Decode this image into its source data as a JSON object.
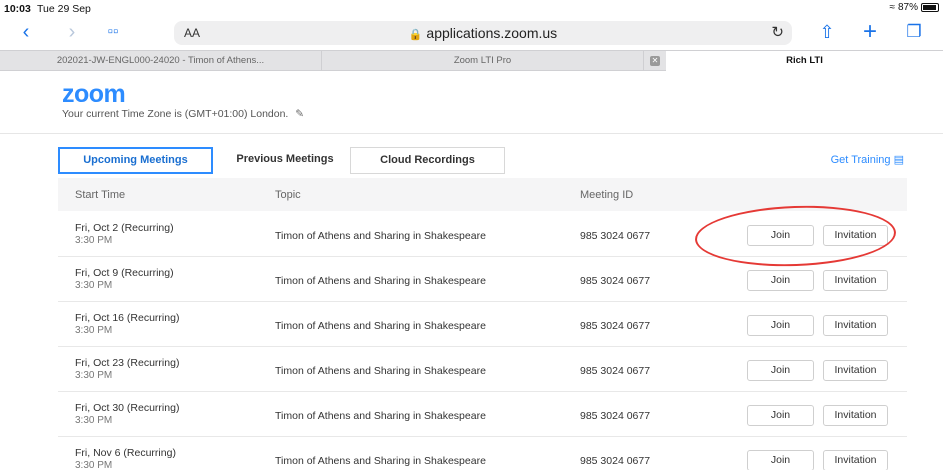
{
  "status_bar": {
    "time": "10:03",
    "date": "Tue 29 Sep",
    "battery": "87%"
  },
  "browser": {
    "text_size_label": "AA",
    "url": "applications.zoom.us",
    "tabs": [
      {
        "label": "202021-JW-ENGL000-24020 - Timon of Athens..."
      },
      {
        "label": "Zoom LTI Pro"
      },
      {
        "label": ""
      },
      {
        "label": "Rich LTI"
      }
    ]
  },
  "zoom": {
    "logo": "zoom",
    "timezone_text": "Your current Time Zone is (GMT+01:00) London.",
    "tabs": [
      "Upcoming Meetings",
      "Previous Meetings",
      "Cloud Recordings"
    ],
    "get_training": "Get Training",
    "columns": {
      "start_time": "Start Time",
      "topic": "Topic",
      "meeting_id": "Meeting ID"
    },
    "join_label": "Join",
    "invitation_label": "Invitation",
    "meetings": [
      {
        "date": "Fri, Oct 2 (Recurring)",
        "time": "3:30 PM",
        "topic": "Timon of Athens and Sharing in Shakespeare",
        "id": "985 3024 0677"
      },
      {
        "date": "Fri, Oct 9 (Recurring)",
        "time": "3:30 PM",
        "topic": "Timon of Athens and Sharing in Shakespeare",
        "id": "985 3024 0677"
      },
      {
        "date": "Fri, Oct 16 (Recurring)",
        "time": "3:30 PM",
        "topic": "Timon of Athens and Sharing in Shakespeare",
        "id": "985 3024 0677"
      },
      {
        "date": "Fri, Oct 23 (Recurring)",
        "time": "3:30 PM",
        "topic": "Timon of Athens and Sharing in Shakespeare",
        "id": "985 3024 0677"
      },
      {
        "date": "Fri, Oct 30 (Recurring)",
        "time": "3:30 PM",
        "topic": "Timon of Athens and Sharing in Shakespeare",
        "id": "985 3024 0677"
      },
      {
        "date": "Fri, Nov 6 (Recurring)",
        "time": "3:30 PM",
        "topic": "Timon of Athens and Sharing in Shakespeare",
        "id": "985 3024 0677"
      }
    ]
  },
  "colors": {
    "accent": "#2d8cff",
    "annotation": "#e53935"
  }
}
